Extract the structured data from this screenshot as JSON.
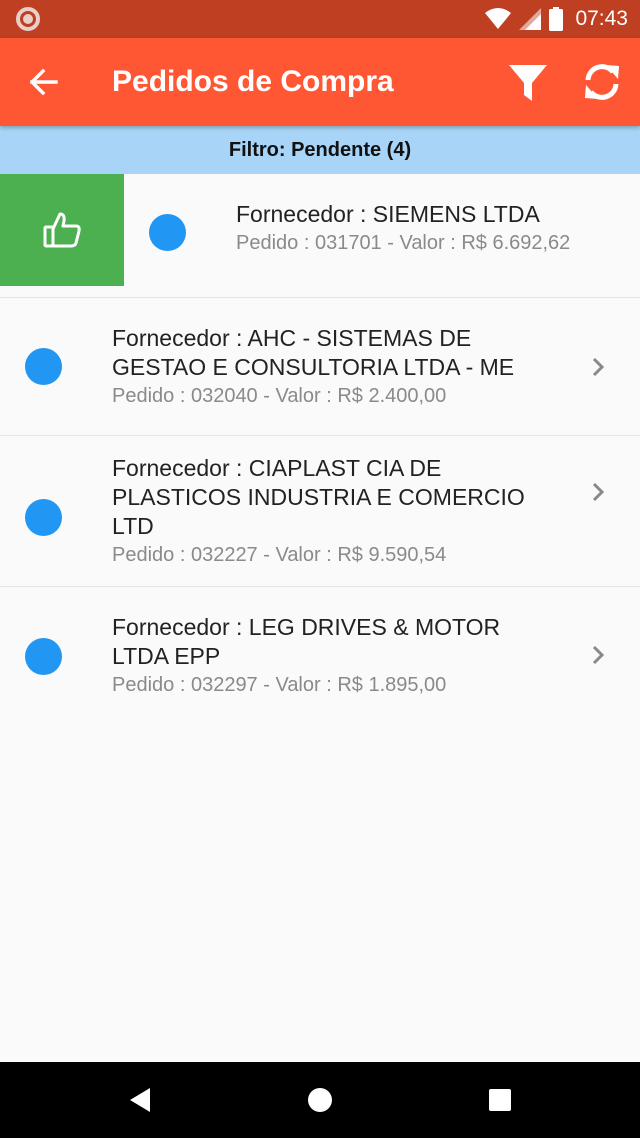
{
  "status_bar": {
    "time": "07:43",
    "icons": [
      "notification-icon",
      "wifi-icon",
      "signal-icon",
      "battery-icon"
    ]
  },
  "app_bar": {
    "title": "Pedidos de Compra",
    "back_icon": "arrow-back-icon",
    "filter_icon": "filter-icon",
    "refresh_icon": "refresh-icon",
    "color": "#ff5733"
  },
  "filter_bar": {
    "text": "Filtro: Pendente (4)",
    "color": "#a8d4f7"
  },
  "orders": [
    {
      "supplier": "Fornecedor : SIEMENS LTDA",
      "details": "Pedido : 031701 - Valor : R$ 6.692,62",
      "swiped": true,
      "action_icon": "thumbs-up-icon",
      "action_color": "#4caf50"
    },
    {
      "supplier": "Fornecedor : AHC - SISTEMAS DE GESTAO E CONSULTORIA LTDA - ME",
      "details": "Pedido : 032040 - Valor : R$ 2.400,00"
    },
    {
      "supplier": "Fornecedor : CIAPLAST CIA DE PLASTICOS INDUSTRIA E COMERCIO LTD",
      "details": "Pedido : 032227 - Valor : R$ 9.590,54"
    },
    {
      "supplier": "Fornecedor : LEG DRIVES & MOTOR LTDA EPP",
      "details": "Pedido : 032297 - Valor : R$ 1.895,00"
    }
  ],
  "status_dot_color": "#2196f3",
  "nav_bar": {
    "icons": [
      "back-triangle-icon",
      "home-circle-icon",
      "recents-square-icon"
    ]
  }
}
